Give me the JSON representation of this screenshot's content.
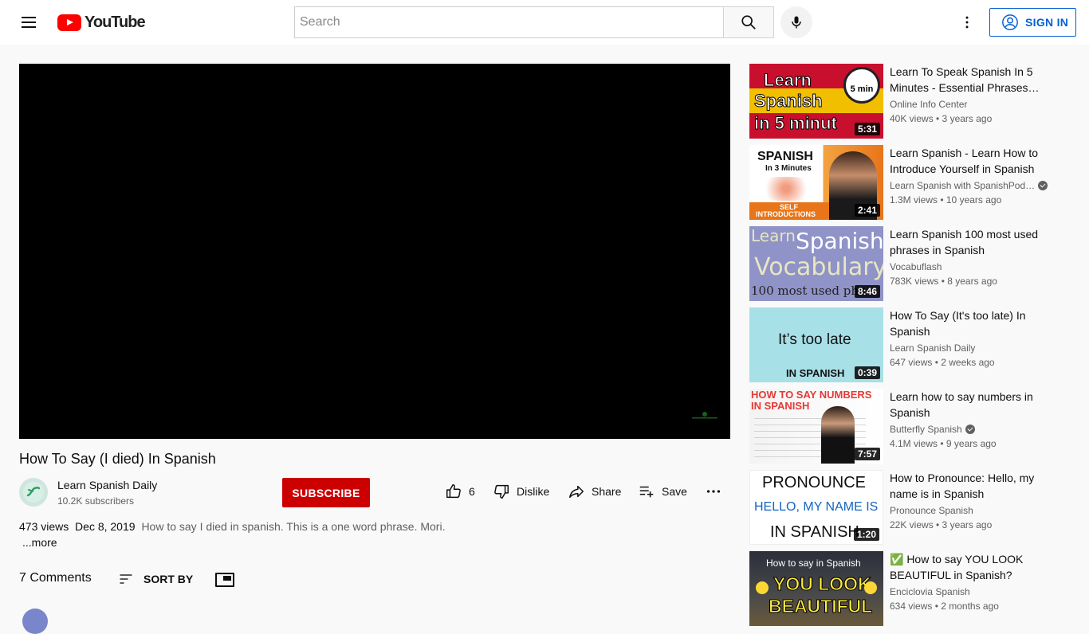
{
  "header": {
    "logo_text": "YouTube",
    "search_placeholder": "Search",
    "signin_label": "SIGN IN"
  },
  "video": {
    "title": "How To Say (I died) In Spanish",
    "channel": "Learn Spanish Daily",
    "subscribers": "10.2K subscribers",
    "subscribe_label": "SUBSCRIBE",
    "likes": "6",
    "dislike_label": "Dislike",
    "share_label": "Share",
    "save_label": "Save",
    "views": "473 views",
    "date": "Dec 8, 2019",
    "description": "How to say I died in spanish. This is a one word phrase. Mori.",
    "more_label": "...more"
  },
  "comments": {
    "count_label": "7 Comments",
    "sort_label": "SORT BY"
  },
  "recommendations": [
    {
      "title": "Learn To Speak Spanish In 5 Minutes - Essential Phrases…",
      "channel": "Online Info Center",
      "verified": false,
      "stats": "40K views • 3 years ago",
      "duration": "5:31",
      "thumb_lines": [
        "Learn",
        "Spanish",
        "in 5 minut"
      ],
      "thumb_badge": "5 min"
    },
    {
      "title": "Learn Spanish - Learn How to Introduce Yourself in Spanish",
      "channel": "Learn Spanish with SpanishPod…",
      "verified": true,
      "stats": "1.3M views • 10 years ago",
      "duration": "2:41",
      "thumb_lines": [
        "SPANISH",
        "In 3 Minutes",
        "SELF",
        "INTRODUCTIONS"
      ]
    },
    {
      "title": "Learn Spanish 100 most used phrases in Spanish",
      "channel": "Vocabuflash",
      "verified": false,
      "stats": "783K views • 8 years ago",
      "duration": "8:46",
      "thumb_lines": [
        "Learn",
        "Spanish",
        "Vocabulary",
        "100 most used phr"
      ]
    },
    {
      "title": "How To Say (It's too late) In Spanish",
      "channel": "Learn Spanish Daily",
      "verified": false,
      "stats": "647 views • 2 weeks ago",
      "duration": "0:39",
      "thumb_lines": [
        "It’s too late",
        "IN SPANISH"
      ]
    },
    {
      "title": "Learn how to say numbers in Spanish",
      "channel": "Butterfly Spanish",
      "verified": true,
      "stats": "4.1M views • 9 years ago",
      "duration": "7:57",
      "thumb_lines": [
        "HOW TO SAY NUMBERS",
        "IN SPANISH"
      ]
    },
    {
      "title": "How to Pronounce: Hello, my name is in Spanish",
      "channel": "Pronounce Spanish",
      "verified": false,
      "stats": "22K views • 3 years ago",
      "duration": "1:20",
      "thumb_lines": [
        "PRONOUNCE",
        "HELLO, MY NAME IS",
        "IN SPANISH"
      ]
    },
    {
      "title": "✅ How to say YOU LOOK BEAUTIFUL in Spanish?",
      "channel": "Enciclovia Spanish",
      "verified": false,
      "stats": "634 views • 2 months ago",
      "duration": "",
      "thumb_lines": [
        "How to say in Spanish",
        "YOU LOOK",
        "BEAUTIFUL"
      ]
    }
  ]
}
